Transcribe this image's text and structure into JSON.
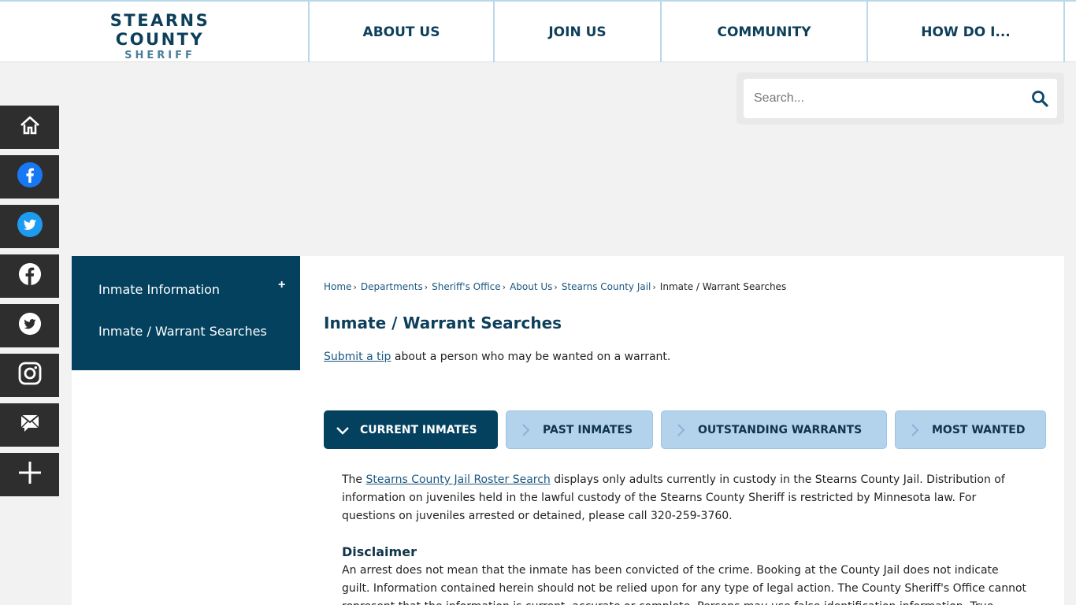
{
  "logo": {
    "main": "STEARNS COUNTY",
    "sub": "SHERIFF"
  },
  "nav": {
    "about": "ABOUT US",
    "join": "JOIN US",
    "community": "COMMUNITY",
    "how": "HOW DO I..."
  },
  "search": {
    "placeholder": "Search..."
  },
  "social": [
    "home-icon",
    "facebook-icon",
    "twitter-icon",
    "facebook-icon",
    "twitter-icon",
    "instagram-icon",
    "email-icon",
    "plus-icon"
  ],
  "sidenav": {
    "items": [
      {
        "label": "Inmate Information"
      },
      {
        "label": "Inmate / Warrant Searches"
      }
    ],
    "toggle": "+"
  },
  "breadcrumb": [
    {
      "label": "Home"
    },
    {
      "label": "Departments"
    },
    {
      "label": "Sheriff's Office"
    },
    {
      "label": "About Us"
    },
    {
      "label": "Stearns County Jail"
    },
    {
      "label": "Inmate / Warrant Searches"
    }
  ],
  "breadcrumb_sep": "›",
  "page_title": "Inmate / Warrant Searches",
  "tip": {
    "link": "Submit a tip",
    "text": " about a person who may be wanted on a warrant."
  },
  "tabs": [
    {
      "label": "CURRENT INMATES"
    },
    {
      "label": "PAST INMATES"
    },
    {
      "label": "OUTSTANDING WARRANTS"
    },
    {
      "label": "MOST WANTED"
    }
  ],
  "current_inmates": {
    "pre": "The ",
    "link": "Stearns County Jail Roster Search",
    "text": " displays only adults currently in custody in the Stearns County Jail. Distribution of information on juveniles held in the lawful custody of the Stearns County Sheriff is restricted by Minnesota law. For questions on juveniles arrested or detained, please call 320-259-3760.",
    "disclaimer_heading": "Disclaimer",
    "disclaimer_text": "An arrest does not mean that the inmate has been convicted of the crime. Booking at the County Jail does not indicate guilt. Information contained herein should not be relied upon for any type of legal action. The County Sheriff's Office cannot represent that the information is current, accurate or complete. Persons may use false identification information. True identity can only be"
  }
}
